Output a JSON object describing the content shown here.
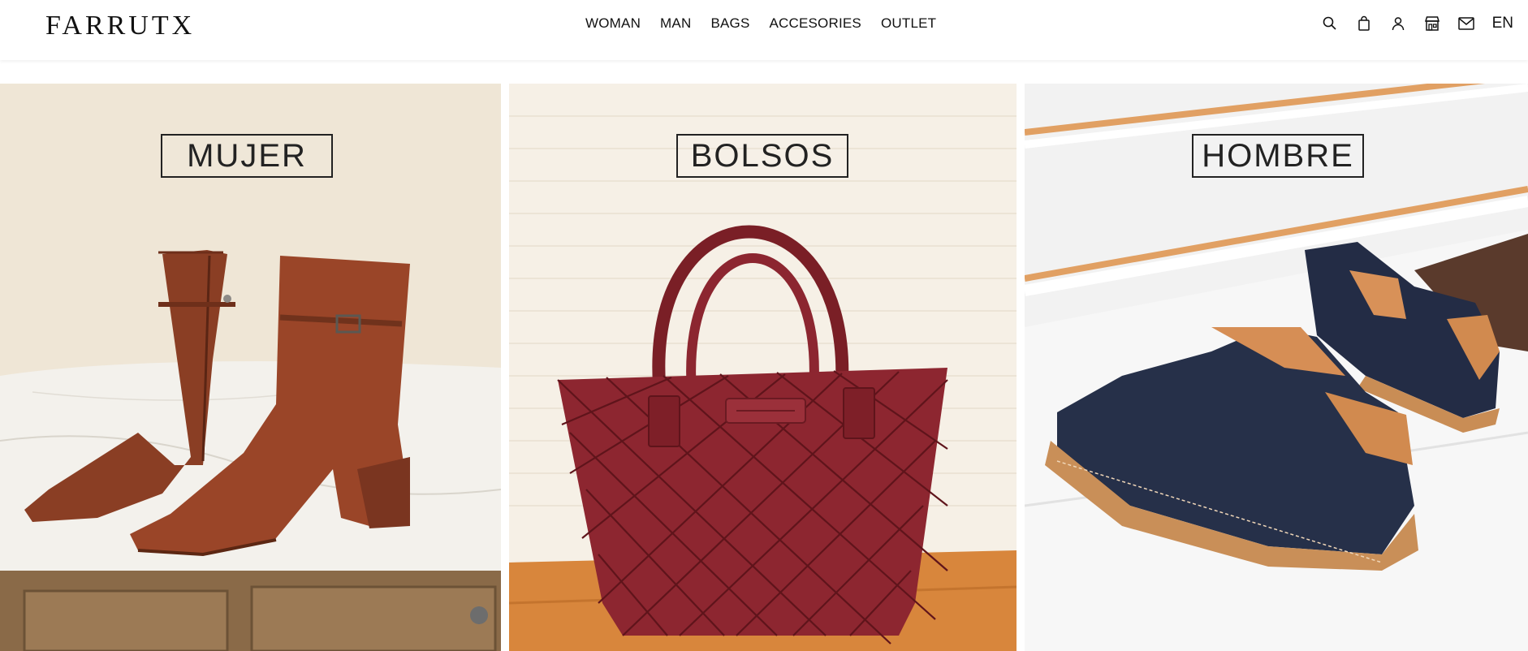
{
  "brand": {
    "logo_text": "FARRUTX"
  },
  "nav": {
    "items": [
      {
        "label": "WOMAN"
      },
      {
        "label": "MAN"
      },
      {
        "label": "BAGS"
      },
      {
        "label": "ACCESORIES"
      },
      {
        "label": "OUTLET"
      }
    ]
  },
  "header_icons": [
    "search-icon",
    "bag-icon",
    "user-icon",
    "store-icon",
    "mail-icon"
  ],
  "language": "EN",
  "panels": [
    {
      "label": "MUJER",
      "image": "suede-ankle-boots",
      "bg": "#efe7d8"
    },
    {
      "label": "BOLSOS",
      "image": "woven-leather-tote-bag",
      "bg": "#f5efe6"
    },
    {
      "label": "HOMBRE",
      "image": "navy-suede-sneakers",
      "bg": "#f2f2f2"
    }
  ]
}
